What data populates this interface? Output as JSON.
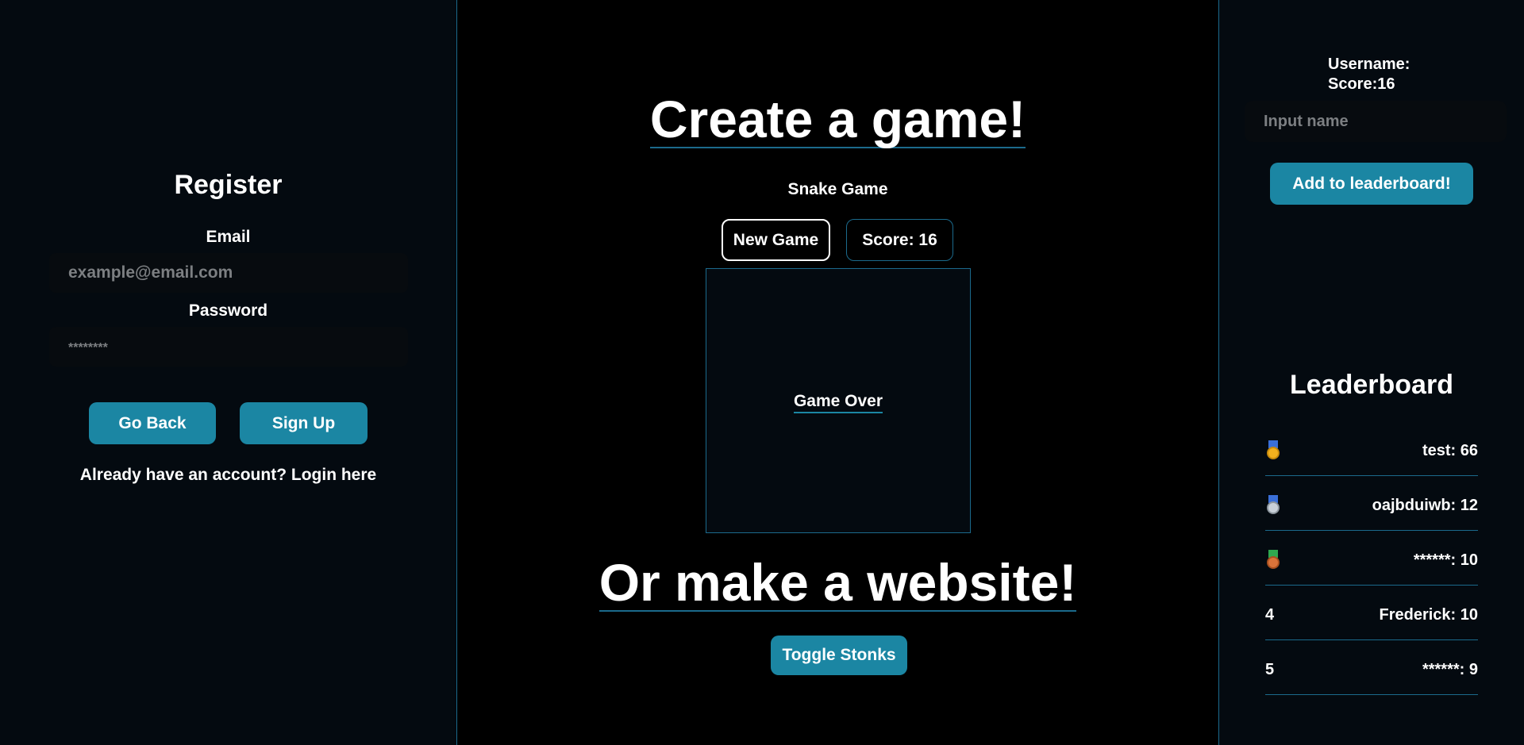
{
  "register": {
    "title": "Register",
    "email_label": "Email",
    "email_placeholder": "example@email.com",
    "password_label": "Password",
    "password_placeholder": "********",
    "go_back_label": "Go Back",
    "sign_up_label": "Sign Up",
    "login_link": "Already have an account? Login here"
  },
  "center": {
    "title_game": "Create a game!",
    "game_name": "Snake Game",
    "new_game_label": "New Game",
    "score_label": "Score: 16",
    "game_over": "Game Over",
    "title_website": "Or make a website!",
    "toggle_label": "Toggle Stonks"
  },
  "user_panel": {
    "username": "Username:",
    "score": "Score:16",
    "name_placeholder": "Input name",
    "add_button_label": "Add to leaderboard!"
  },
  "leaderboard": {
    "title": "Leaderboard",
    "rows": [
      {
        "rank": "",
        "medal": "gold-medal-icon",
        "entry": "test: 66"
      },
      {
        "rank": "",
        "medal": "silver-medal-icon",
        "entry": "oajbduiwb: 12"
      },
      {
        "rank": "",
        "medal": "bronze-medal-icon",
        "entry": "******: 10"
      },
      {
        "rank": "4",
        "medal": "",
        "entry": "Frederick: 10"
      },
      {
        "rank": "5",
        "medal": "",
        "entry": "******: 9"
      }
    ]
  },
  "colors": {
    "accent": "#1b86a3",
    "border": "#1b6a8c",
    "panel_bg": "#040a10",
    "center_bg": "#000000"
  }
}
